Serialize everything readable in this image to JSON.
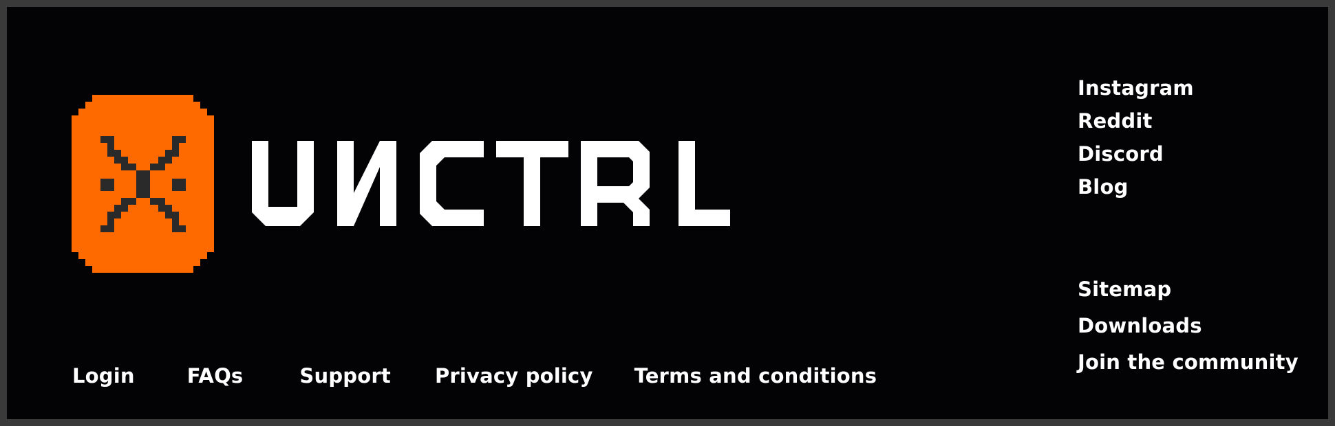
{
  "brand": {
    "name": "UNCTRL",
    "logo_icon": "pixel-x-icon",
    "colors": {
      "badge": "#ff6a00",
      "badge_glyph": "#2a2a2a",
      "text": "#ffffff",
      "background": "#030306"
    }
  },
  "social_links": [
    {
      "label": "Instagram"
    },
    {
      "label": "Reddit"
    },
    {
      "label": "Discord"
    },
    {
      "label": "Blog"
    }
  ],
  "extra_links": [
    {
      "label": "Sitemap"
    },
    {
      "label": "Downloads"
    },
    {
      "label": "Join the community"
    }
  ],
  "footer_links": [
    {
      "label": "Login"
    },
    {
      "label": "FAQs"
    },
    {
      "label": "Support"
    },
    {
      "label": "Privacy policy"
    },
    {
      "label": "Terms and conditions"
    }
  ]
}
